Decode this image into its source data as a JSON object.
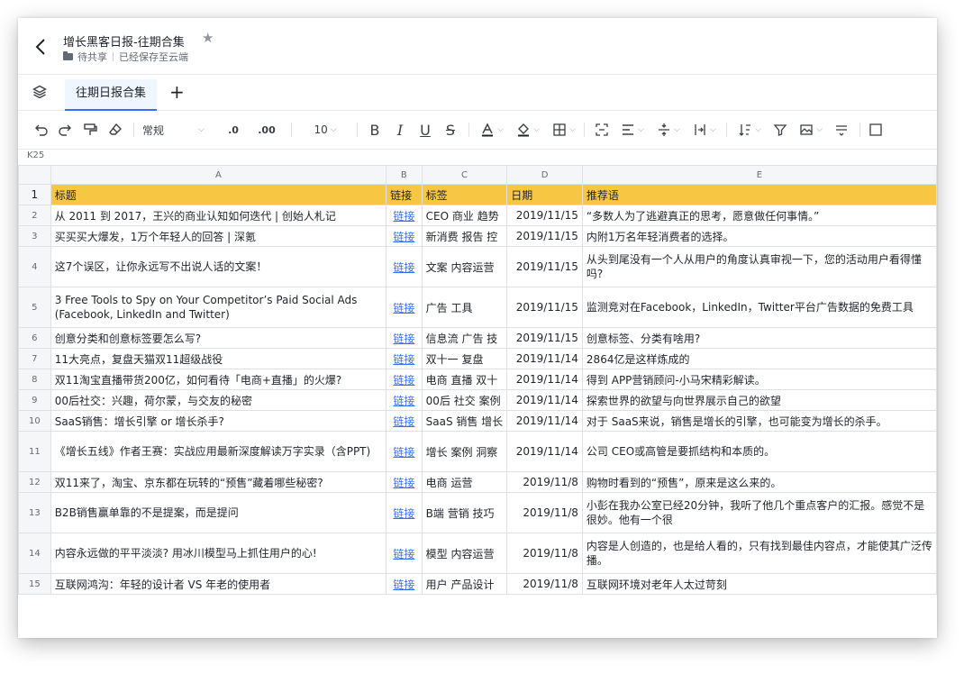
{
  "doc": {
    "title": "增长黑客日报-往期合集",
    "star": "★",
    "folder": "待共享",
    "save_status": "已经保存至云端"
  },
  "tabs": {
    "active": "往期日报合集",
    "add": "+"
  },
  "toolbar": {
    "font_style": "常规",
    "font_size": "10",
    "bold": "B",
    "italic": "I",
    "underline": "U",
    "strike": "S",
    "decimal_decrease": ".0",
    "decimal_increase": ".00"
  },
  "cell_ref": "K25",
  "columns": [
    "A",
    "B",
    "C",
    "D",
    "E"
  ],
  "header_row": {
    "num": "1",
    "cells": [
      "标题",
      "链接",
      "标签",
      "日期",
      "推荐语"
    ]
  },
  "rows": [
    {
      "num": "2",
      "title": "从 2011 到 2017，王兴的商业认知如何迭代 | 创始人札记",
      "link": "链接",
      "tags": "CEO 商业 趋势",
      "date": "2019/11/15",
      "rec": "“多数人为了逃避真正的思考，愿意做任何事情。”"
    },
    {
      "num": "3",
      "title": "买买买大爆发，1万个年轻人的回答 | 深氪",
      "link": "链接",
      "tags": "新消费 报告 控",
      "date": "2019/11/15",
      "rec": "内附1万名年轻消费者的选择。"
    },
    {
      "num": "4",
      "title": "这7个误区，让你永远写不出说人话的文案！",
      "link": "链接",
      "tags": "文案 内容运营",
      "date": "2019/11/15",
      "rec": "从头到尾没有一个人从用户的角度认真审视一下，您的活动用户看得懂吗?"
    },
    {
      "num": "5",
      "title": "3 Free Tools to Spy on Your Competitor’s Paid Social Ads (Facebook, LinkedIn and Twitter)",
      "link": "链接",
      "tags": "广告 工具",
      "date": "2019/11/15",
      "rec": "监测竞对在Facebook，LinkedIn，Twitter平台广告数据的免费工具"
    },
    {
      "num": "6",
      "title": "创意分类和创意标签要怎么写?",
      "link": "链接",
      "tags": "信息流 广告 技",
      "date": "2019/11/15",
      "rec": "创意标签、分类有啥用?"
    },
    {
      "num": "7",
      "title": "11大亮点，复盘天猫双11超级战役",
      "link": "链接",
      "tags": "双十一 复盘",
      "date": "2019/11/14",
      "rec": "2864亿是这样炼成的"
    },
    {
      "num": "8",
      "title": "双11淘宝直播带货200亿，如何看待「电商+直播」的火爆?",
      "link": "链接",
      "tags": "电商 直播 双十",
      "date": "2019/11/14",
      "rec": "得到 APP营销顾问-小马宋精彩解读。"
    },
    {
      "num": "9",
      "title": "00后社交：兴趣，荷尔蒙，与交友的秘密",
      "link": "链接",
      "tags": "00后 社交 案例",
      "date": "2019/11/14",
      "rec": "探索世界的欲望与向世界展示自己的欲望"
    },
    {
      "num": "10",
      "title": "SaaS销售：增长引擎 or 增长杀手?",
      "link": "链接",
      "tags": "SaaS 销售 增长",
      "date": "2019/11/14",
      "rec": "对于 SaaS来说，销售是增长的引擎，也可能变为增长的杀手。"
    },
    {
      "num": "11",
      "title": "《增长五线》作者王赛：实战应用最新深度解读万字实录（含PPT)",
      "link": "链接",
      "tags": "增长 案例 洞察",
      "date": "2019/11/14",
      "rec": "公司 CEO或高管是要抓结构和本质的。"
    },
    {
      "num": "12",
      "title": "双11来了，淘宝、京东都在玩转的“预售”藏着哪些秘密?",
      "link": "链接",
      "tags": "电商 运营",
      "date": "2019/11/8",
      "rec": "购物时看到的“预售”，原来是这么来的。"
    },
    {
      "num": "13",
      "title": "B2B销售赢单靠的不是提案，而是提问",
      "link": "链接",
      "tags": "B端 营销 技巧",
      "date": "2019/11/8",
      "rec": "小彭在我办公室已经20分钟，我听了他几个重点客户的汇报。感觉不是很妙。他有一个很"
    },
    {
      "num": "14",
      "title": "内容永远做的平平淡淡? 用冰川模型马上抓住用户的心!",
      "link": "链接",
      "tags": "模型 内容运营",
      "date": "2019/11/8",
      "rec": "内容是人创造的，也是给人看的，只有找到最佳内容点，才能使其广泛传播。"
    },
    {
      "num": "15",
      "title": "互联网鸿沟：年轻的设计者 VS 年老的使用者",
      "link": "链接",
      "tags": "用户 产品设计",
      "date": "2019/11/8",
      "rec": "互联网环境对老年人太过苛刻"
    }
  ]
}
